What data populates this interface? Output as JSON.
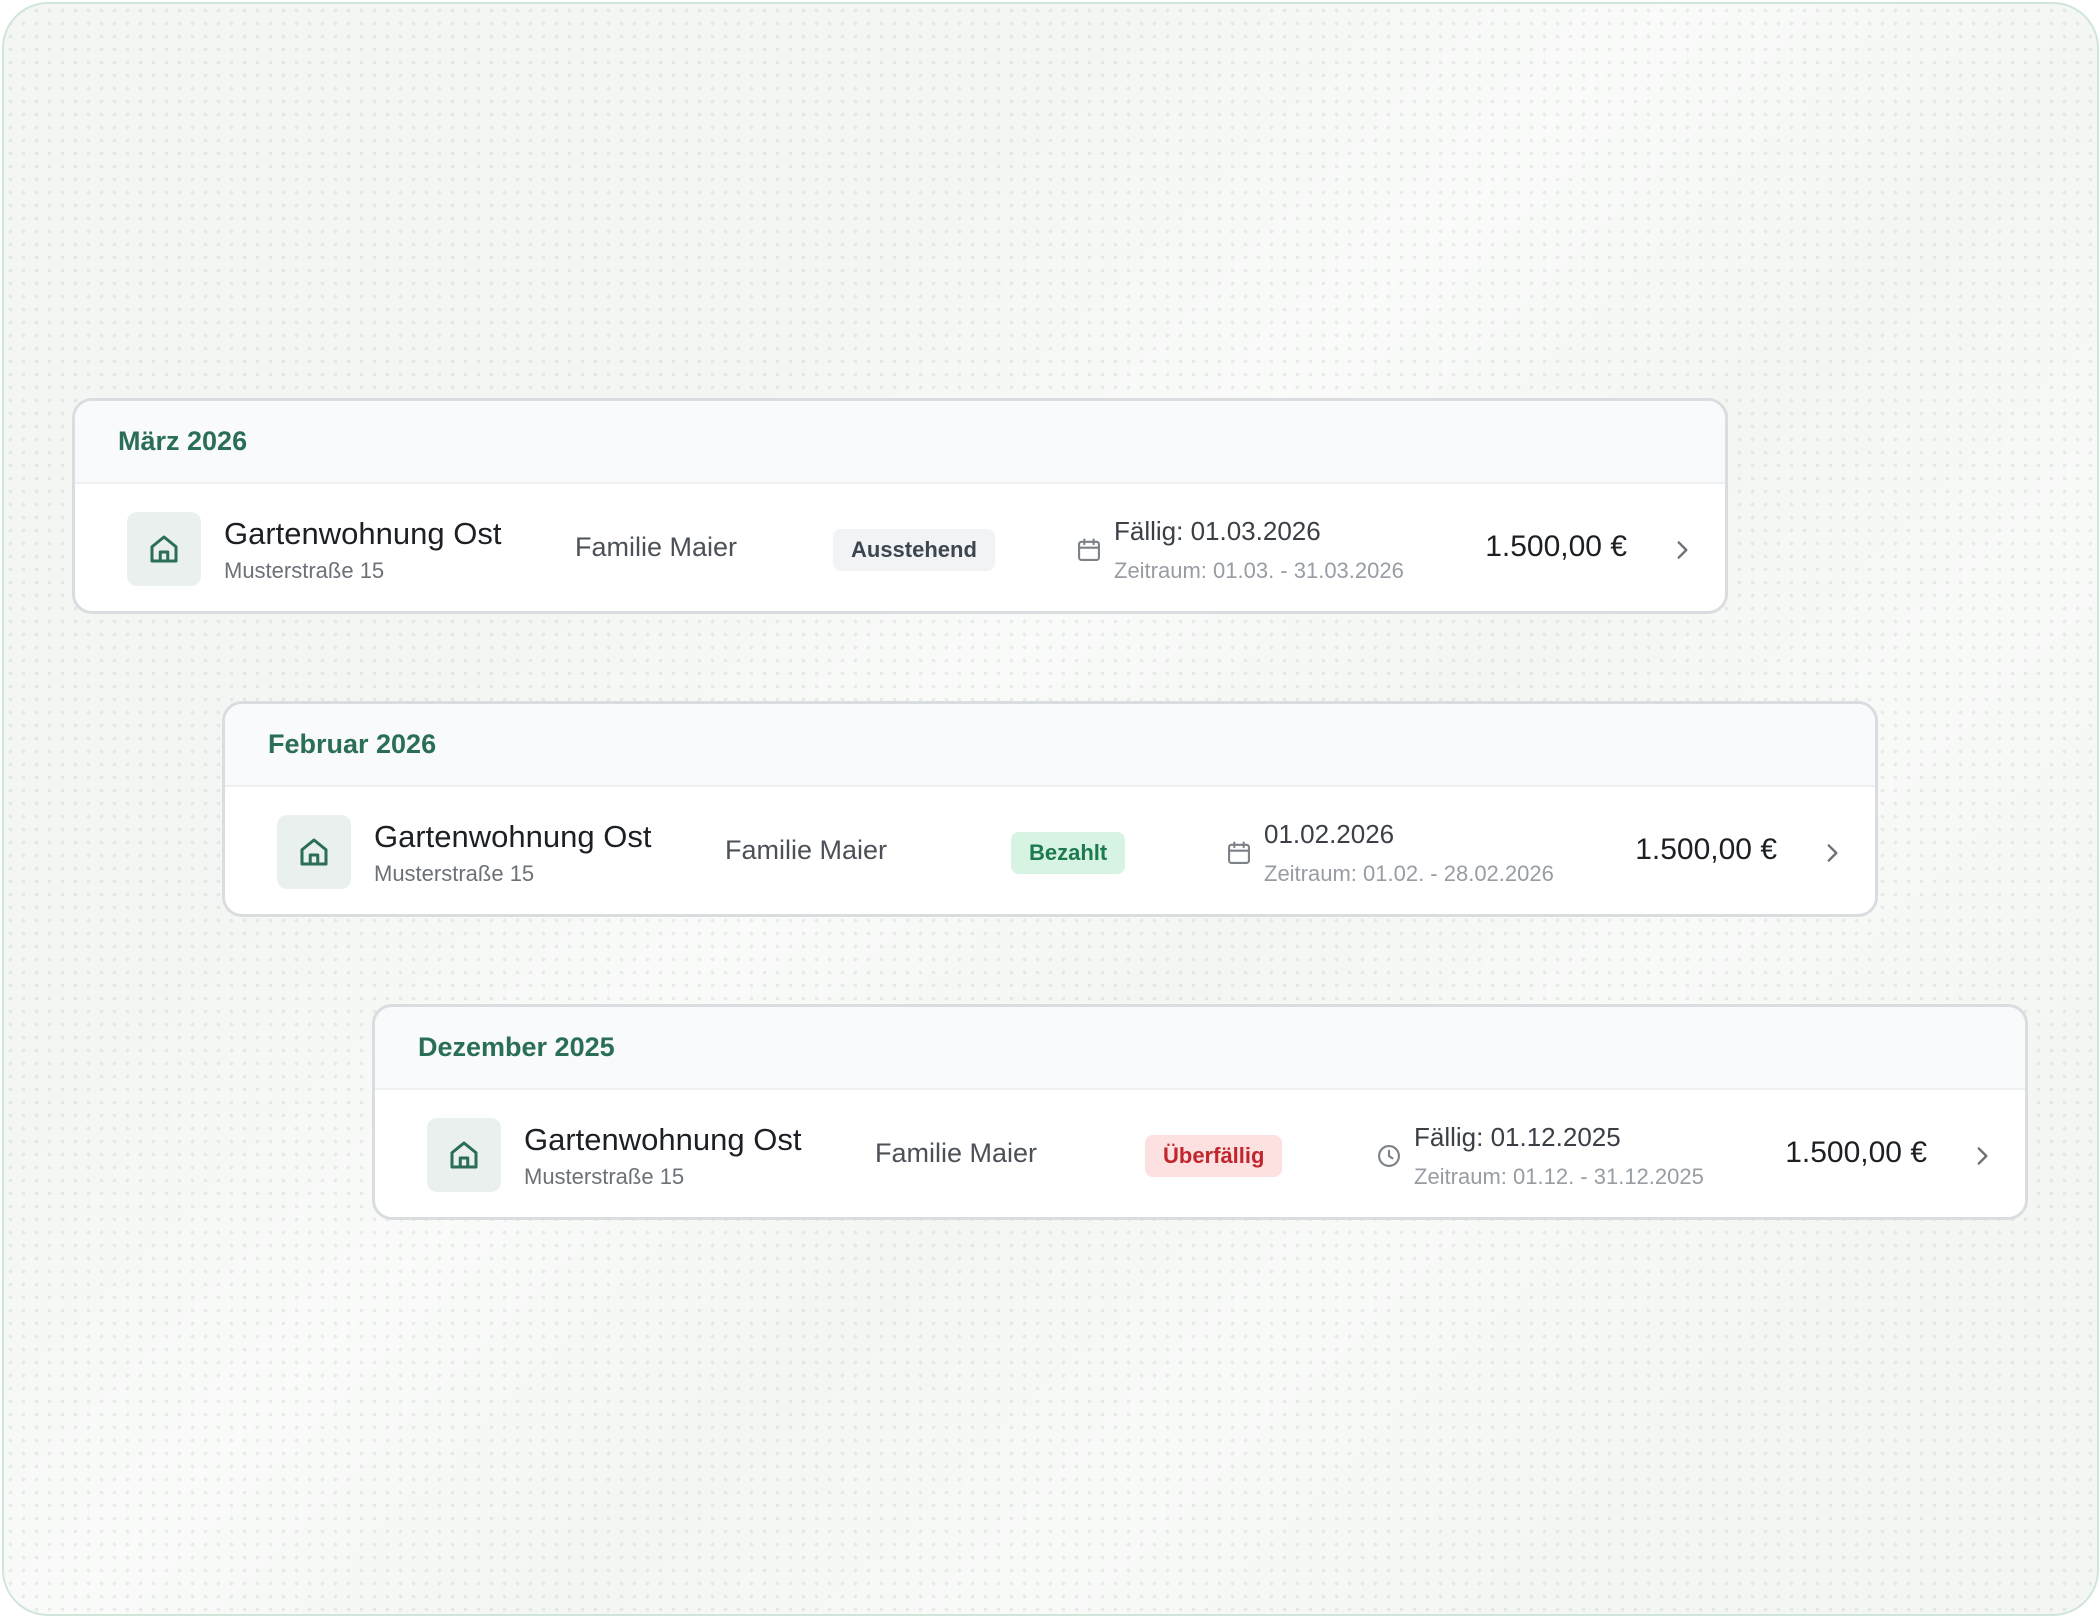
{
  "colors": {
    "accent": "#2a6e57",
    "pending_bg": "#f1f3f5",
    "paid_bg": "#d7f3e3",
    "paid_text": "#1d7a4e",
    "overdue_bg": "#fde1e1",
    "overdue_text": "#c0262d"
  },
  "groups": [
    {
      "month": "März 2026",
      "items": [
        {
          "property_name": "Gartenwohnung Ost",
          "property_address": "Musterstraße 15",
          "tenant": "Familie Maier",
          "status": "Ausstehend",
          "status_type": "pending",
          "due_icon": "calendar-icon",
          "due_date": "Fällig: 01.03.2026",
          "period": "Zeitraum: 01.03. - 31.03.2026",
          "amount": "1.500,00 €"
        }
      ]
    },
    {
      "month": "Februar 2026",
      "items": [
        {
          "property_name": "Gartenwohnung Ost",
          "property_address": "Musterstraße 15",
          "tenant": "Familie Maier",
          "status": "Bezahlt",
          "status_type": "paid",
          "due_icon": "calendar-icon",
          "due_date": "01.02.2026",
          "period": "Zeitraum: 01.02. - 28.02.2026",
          "amount": "1.500,00 €"
        }
      ]
    },
    {
      "month": "Dezember 2025",
      "items": [
        {
          "property_name": "Gartenwohnung Ost",
          "property_address": "Musterstraße 15",
          "tenant": "Familie Maier",
          "status": "Überfällig",
          "status_type": "overdue",
          "due_icon": "clock-icon",
          "due_date": "Fällig: 01.12.2025",
          "period": "Zeitraum: 01.12. - 31.12.2025",
          "amount": "1.500,00 €"
        }
      ]
    }
  ]
}
